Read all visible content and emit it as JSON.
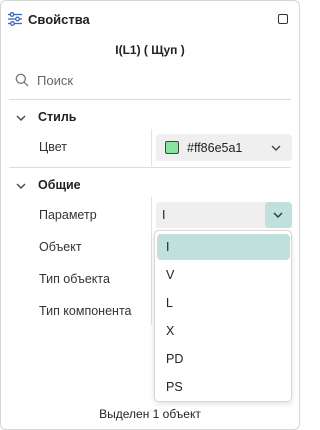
{
  "header": {
    "title": "Свойства",
    "icon": "sliders-icon",
    "window_button_icon": "maximize-icon"
  },
  "subtitle": "I(L1) ( Щуп )",
  "search": {
    "placeholder": "Поиск",
    "value": "",
    "icon": "search-icon"
  },
  "sections": {
    "style": {
      "label": "Стиль",
      "expanded": true,
      "color": {
        "label": "Цвет",
        "value": "#ff86e5a1",
        "swatch": "#86e5a1"
      }
    },
    "general": {
      "label": "Общие",
      "expanded": true,
      "parameter": {
        "label": "Параметр",
        "value": "I",
        "options": [
          "I",
          "V",
          "L",
          "X",
          "PD",
          "PS"
        ],
        "selected_index": 0
      },
      "object": {
        "label": "Объект"
      },
      "object_type": {
        "label": "Тип объекта"
      },
      "component_type": {
        "label": "Тип компонента"
      }
    }
  },
  "status": "Выделен 1 объект",
  "colors": {
    "accent": "#bfe0dd",
    "field_bg": "#efefef",
    "divider": "#dcdcdc"
  }
}
